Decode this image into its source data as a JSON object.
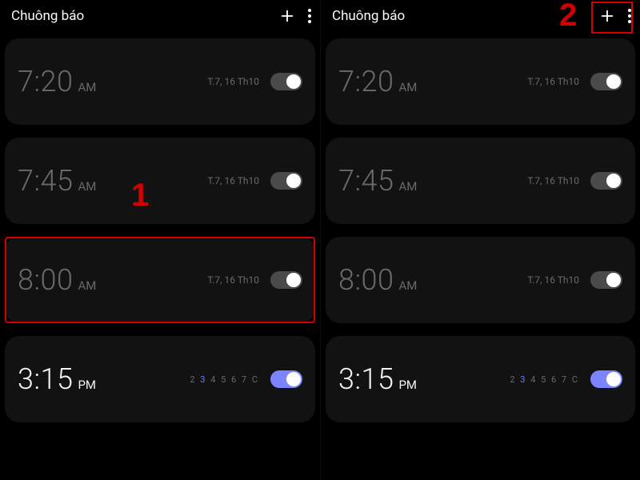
{
  "left": {
    "title": "Chuông báo",
    "alarms": [
      {
        "time": "7:20",
        "ampm": "AM",
        "sub": "T.7, 16 Th10",
        "on": false,
        "daysMode": false
      },
      {
        "time": "7:45",
        "ampm": "AM",
        "sub": "T.7, 16 Th10",
        "on": false,
        "daysMode": false
      },
      {
        "time": "8:00",
        "ampm": "AM",
        "sub": "T.7, 16 Th10",
        "on": false,
        "daysMode": false
      },
      {
        "time": "3:15",
        "ampm": "PM",
        "sub": "",
        "on": true,
        "daysMode": true,
        "days": [
          "2",
          "3",
          "4",
          "5",
          "6",
          "7",
          "C"
        ],
        "hlIndex": 1
      }
    ],
    "annotation": {
      "label": "1"
    }
  },
  "right": {
    "title": "Chuông báo",
    "alarms": [
      {
        "time": "7:20",
        "ampm": "AM",
        "sub": "T.7, 16 Th10",
        "on": false,
        "daysMode": false
      },
      {
        "time": "7:45",
        "ampm": "AM",
        "sub": "T.7, 16 Th10",
        "on": false,
        "daysMode": false
      },
      {
        "time": "8:00",
        "ampm": "AM",
        "sub": "T.7, 16 Th10",
        "on": false,
        "daysMode": false
      },
      {
        "time": "3:15",
        "ampm": "PM",
        "sub": "",
        "on": true,
        "daysMode": true,
        "days": [
          "2",
          "3",
          "4",
          "5",
          "6",
          "7",
          "C"
        ],
        "hlIndex": 1
      }
    ],
    "annotation": {
      "label": "2"
    }
  }
}
